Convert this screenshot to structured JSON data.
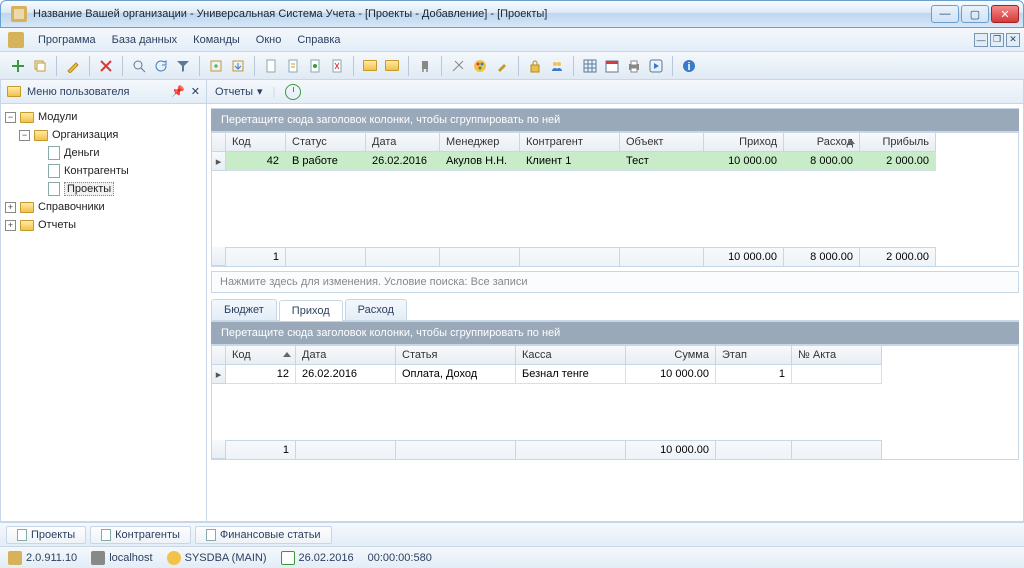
{
  "window": {
    "title": "Название Вашей организации - Универсальная Система Учета - [Проекты - Добавление] - [Проекты]"
  },
  "menu": {
    "program": "Программа",
    "database": "База данных",
    "commands": "Команды",
    "window": "Окно",
    "help": "Справка"
  },
  "sidebar": {
    "title": "Меню пользователя",
    "nodes": {
      "modules": "Модули",
      "organization": "Организация",
      "money": "Деньги",
      "contractors": "Контрагенты",
      "projects": "Проекты",
      "refs": "Справочники",
      "reports": "Отчеты"
    }
  },
  "reportsbar": {
    "label": "Отчеты"
  },
  "group_hint": "Перетащите сюда заголовок колонки, чтобы сгруппировать по ней",
  "top_grid": {
    "headers": {
      "code": "Код",
      "status": "Статус",
      "date": "Дата",
      "manager": "Менеджер",
      "contractor": "Контрагент",
      "object": "Объект",
      "income": "Приход",
      "expense": "Расход",
      "profit": "Прибыль"
    },
    "rows": [
      {
        "code": "42",
        "status": "В работе",
        "date": "26.02.2016",
        "manager": "Акулов Н.Н.",
        "contractor": "Клиент 1",
        "object": "Тест",
        "income": "10 000.00",
        "expense": "8 000.00",
        "profit": "2 000.00"
      }
    ],
    "totals": {
      "count": "1",
      "income": "10 000.00",
      "expense": "8 000.00",
      "profit": "2 000.00"
    }
  },
  "search_hint": "Нажмите здесь для изменения. Условие поиска: Все записи",
  "detail_tabs": {
    "budget": "Бюджет",
    "income": "Приход",
    "expense": "Расход"
  },
  "bottom_grid": {
    "headers": {
      "code": "Код",
      "date": "Дата",
      "article": "Статья",
      "cash": "Касса",
      "sum": "Сумма",
      "stage": "Этап",
      "act": "№ Акта"
    },
    "rows": [
      {
        "code": "12",
        "date": "26.02.2016",
        "article": "Оплата, Доход",
        "cash": "Безнал тенге",
        "sum": "10 000.00",
        "stage": "1",
        "act": ""
      }
    ],
    "totals": {
      "count": "1",
      "sum": "10 000.00"
    }
  },
  "bottom_tabs": {
    "projects": "Проекты",
    "contractors": "Контрагенты",
    "fin": "Финансовые статьи"
  },
  "status": {
    "version": "2.0.911.10",
    "host": "localhost",
    "user": "SYSDBA (MAIN)",
    "date": "26.02.2016",
    "time": "00:00:00:580"
  },
  "colors": {
    "accent": "#6b9fcf",
    "row_green": "#c8ecc8"
  }
}
